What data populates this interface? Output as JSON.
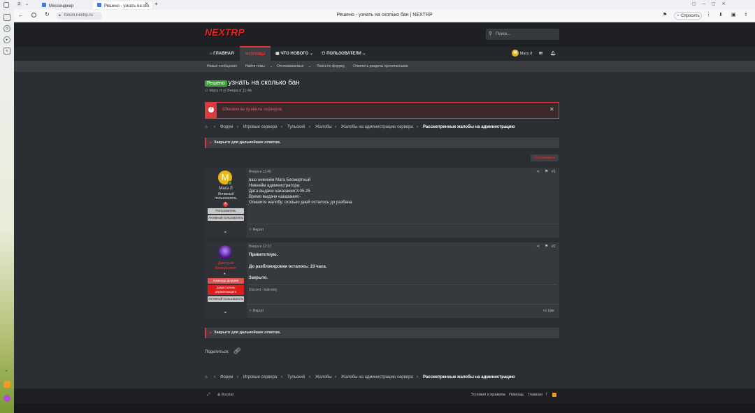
{
  "browser": {
    "tabs": [
      {
        "label": "Мессенджер"
      },
      {
        "label": "Решено - узнать на ско",
        "active": true
      }
    ],
    "tab_count": "2",
    "url": "forum.nextrp.ru",
    "page_title": "Решено - узнать на сколько бан | NEXTRP",
    "ask_label": "Спросить"
  },
  "site": {
    "logo": "NEXTRP",
    "search_placeholder": "Поиск...",
    "nav": {
      "home": "ГЛАВНАЯ",
      "forums": "ФОРУМЫ",
      "whats_new": "ЧТО НОВОГО",
      "users": "ПОЛЬЗОВАТЕЛИ",
      "username": "Мага Л"
    },
    "subnav": [
      "Новые сообщения",
      "Найти темы",
      "Отслеживаемые",
      "Поиск по форуму",
      "Отметить разделы прочитанными"
    ],
    "thread": {
      "badge": "Решено",
      "title": "узнать на сколько бан",
      "author": "Мага Л",
      "date": "Вчера в 11:46"
    },
    "notice": "Обновлены правила серверов.",
    "breadcrumbs": [
      "Форум",
      "Игровые сервера",
      "Тульский",
      "Жалобы",
      "Жалобы на администрацию сервера",
      "Рассмотренные жалобы на администрацию"
    ],
    "closed_text": "Закрыто для дальнейших ответов.",
    "follow_button": "Отслеживать",
    "posts": [
      {
        "date": "Вчера в 11:46",
        "num": "#1",
        "user": "Мага Л",
        "avatar_letter": "М",
        "title": "Активный пользователь",
        "roles": [
          "Пользователь",
          "Активный пользователь"
        ],
        "lines": [
          "ваш никнейм Мага Бесмертный",
          "Никнейм администратора:",
          "Дата выдачи наказания:3.05.25",
          "Время выдачи наказания:-",
          "Опишите жалобу: сколько дней осталось до разбана"
        ],
        "report": "Report"
      },
      {
        "date": "Вчера в 12:27",
        "num": "#2",
        "user": "Дмитрий Валерьевич",
        "roles": [
          "Команда форума",
          "Заместитель управляющего",
          "Активный пользователь"
        ],
        "lines": [
          "Приветствую.",
          "До разблокировки осталось: 23 часа.",
          "Закрыто."
        ],
        "signature": "Discord - balinskiy",
        "report": "Report",
        "like": "Like"
      }
    ],
    "share_label": "Поделиться:",
    "footer": {
      "language": "Russian",
      "terms": "Условия и правила",
      "help": "Помощь",
      "home": "Главная"
    }
  }
}
